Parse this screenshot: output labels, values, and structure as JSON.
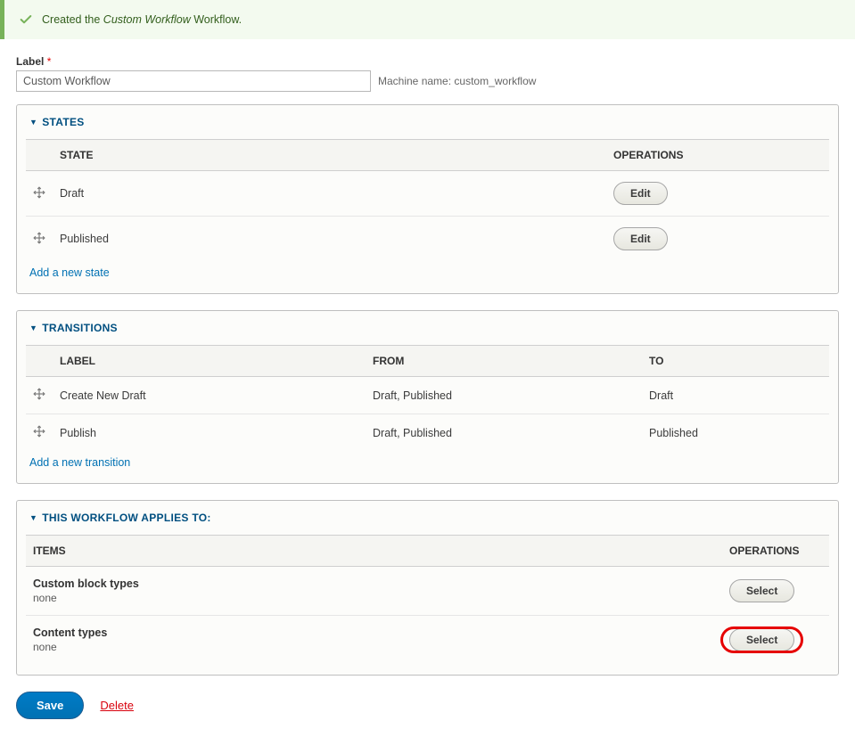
{
  "status_message": {
    "prefix": "Created the ",
    "emphasis": "Custom Workflow",
    "suffix": " Workflow."
  },
  "label_field": {
    "label": "Label",
    "value": "Custom Workflow",
    "machine_prefix": "Machine name: ",
    "machine_name": "custom_workflow"
  },
  "states": {
    "heading": "States",
    "columns": {
      "state": "State",
      "operations": "Operations"
    },
    "rows": [
      {
        "name": "Draft",
        "op": "Edit"
      },
      {
        "name": "Published",
        "op": "Edit"
      }
    ],
    "add_link": "Add a new state"
  },
  "transitions": {
    "heading": "Transitions",
    "columns": {
      "label": "Label",
      "from": "From",
      "to": "To"
    },
    "rows": [
      {
        "label": "Create New Draft",
        "from": "Draft, Published",
        "to": "Draft"
      },
      {
        "label": "Publish",
        "from": "Draft, Published",
        "to": "Published"
      }
    ],
    "add_link": "Add a new transition"
  },
  "applies": {
    "heading": "This workflow applies to:",
    "columns": {
      "items": "Items",
      "operations": "Operations"
    },
    "rows": [
      {
        "item": "Custom block types",
        "none": "none",
        "op": "Select",
        "highlight": false
      },
      {
        "item": "Content types",
        "none": "none",
        "op": "Select",
        "highlight": true
      }
    ]
  },
  "actions": {
    "save": "Save",
    "delete": "Delete"
  }
}
